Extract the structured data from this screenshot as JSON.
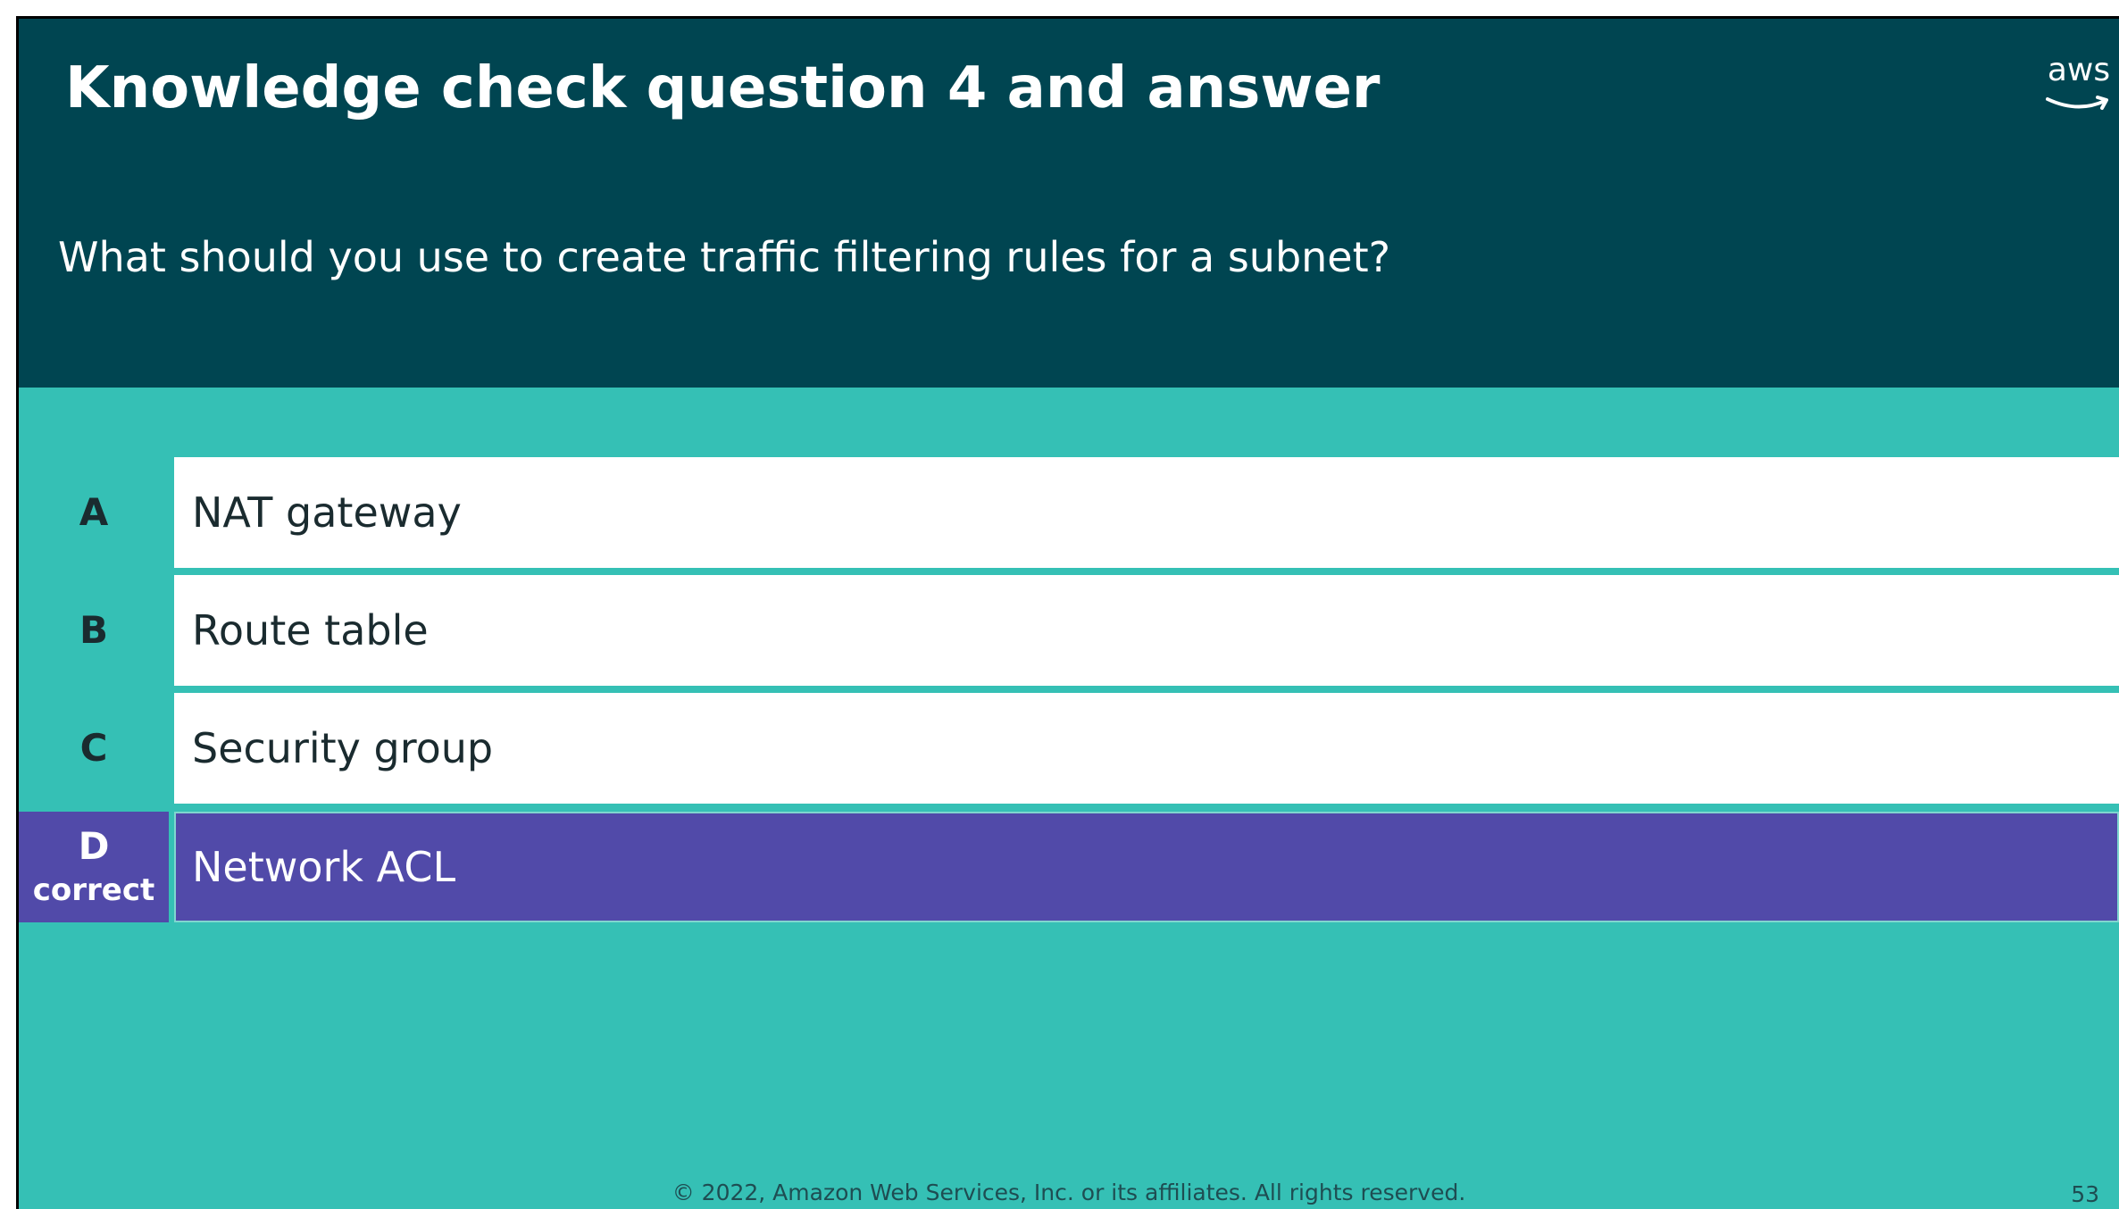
{
  "slide": {
    "title": "Knowledge check question 4 and answer",
    "question": "What should you use to create traffic filtering rules for a subnet?",
    "logo_text": "aws",
    "logo_icon": "aws-logo-icon",
    "options": [
      {
        "letter": "A",
        "status": "",
        "text": "NAT gateway",
        "correct": false
      },
      {
        "letter": "B",
        "status": "",
        "text": "Route table",
        "correct": false
      },
      {
        "letter": "C",
        "status": "",
        "text": "Security group",
        "correct": false
      },
      {
        "letter": "D",
        "status": "correct",
        "text": "Network ACL",
        "correct": true
      }
    ],
    "footer": "© 2022, Amazon Web Services, Inc. or its affiliates. All rights reserved.",
    "page_number": "53"
  },
  "colors": {
    "header_bg": "#004551",
    "body_bg": "#35c0b5",
    "option_bg": "#ffffff",
    "correct_bg": "#514aa9",
    "dark_text": "#1a2b2f"
  }
}
